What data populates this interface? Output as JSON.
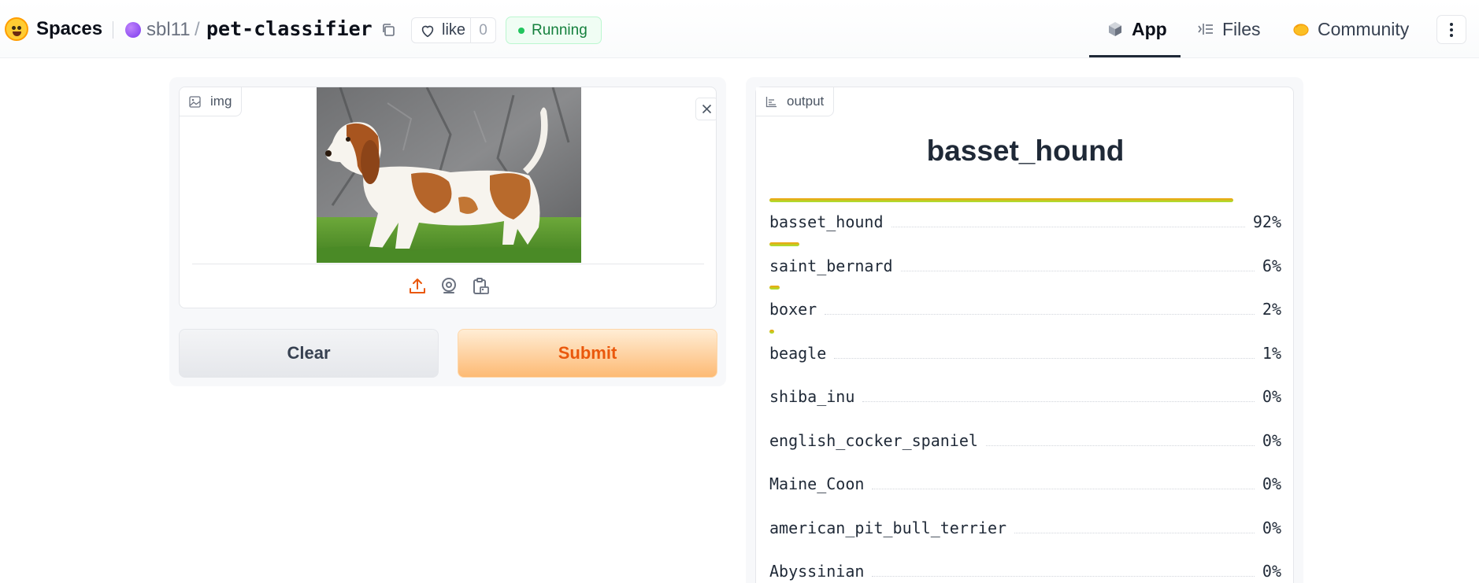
{
  "header": {
    "brand": "Spaces",
    "owner": "sbl11",
    "separator": "/",
    "repo": "pet-classifier",
    "like_label": "like",
    "like_count": "0",
    "status": "Running",
    "tabs": [
      {
        "label": "App",
        "icon": "app-cube-icon",
        "active": true
      },
      {
        "label": "Files",
        "icon": "files-list-icon",
        "active": false
      },
      {
        "label": "Community",
        "icon": "community-hand-icon",
        "active": false
      }
    ]
  },
  "input": {
    "label": "img",
    "sources": [
      "upload-icon",
      "webcam-icon",
      "clipboard-icon"
    ],
    "clear_label": "Clear",
    "submit_label": "Submit"
  },
  "output": {
    "label": "output",
    "title": "basset_hound",
    "confidences": [
      {
        "label": "basset_hound",
        "value": "92%",
        "fraction": 0.92
      },
      {
        "label": "saint_bernard",
        "value": "6%",
        "fraction": 0.06
      },
      {
        "label": "boxer",
        "value": "2%",
        "fraction": 0.02
      },
      {
        "label": "beagle",
        "value": "1%",
        "fraction": 0.01
      },
      {
        "label": "shiba_inu",
        "value": "0%",
        "fraction": 0.0
      },
      {
        "label": "english_cocker_spaniel",
        "value": "0%",
        "fraction": 0.0
      },
      {
        "label": "Maine_Coon",
        "value": "0%",
        "fraction": 0.0
      },
      {
        "label": "american_pit_bull_terrier",
        "value": "0%",
        "fraction": 0.0
      },
      {
        "label": "Abyssinian",
        "value": "0%",
        "fraction": 0.0
      }
    ]
  },
  "colors": {
    "accent": "#ea580c",
    "status_green": "#15803d",
    "bar_start": "#f59e0b",
    "bar_end": "#a3e635"
  }
}
